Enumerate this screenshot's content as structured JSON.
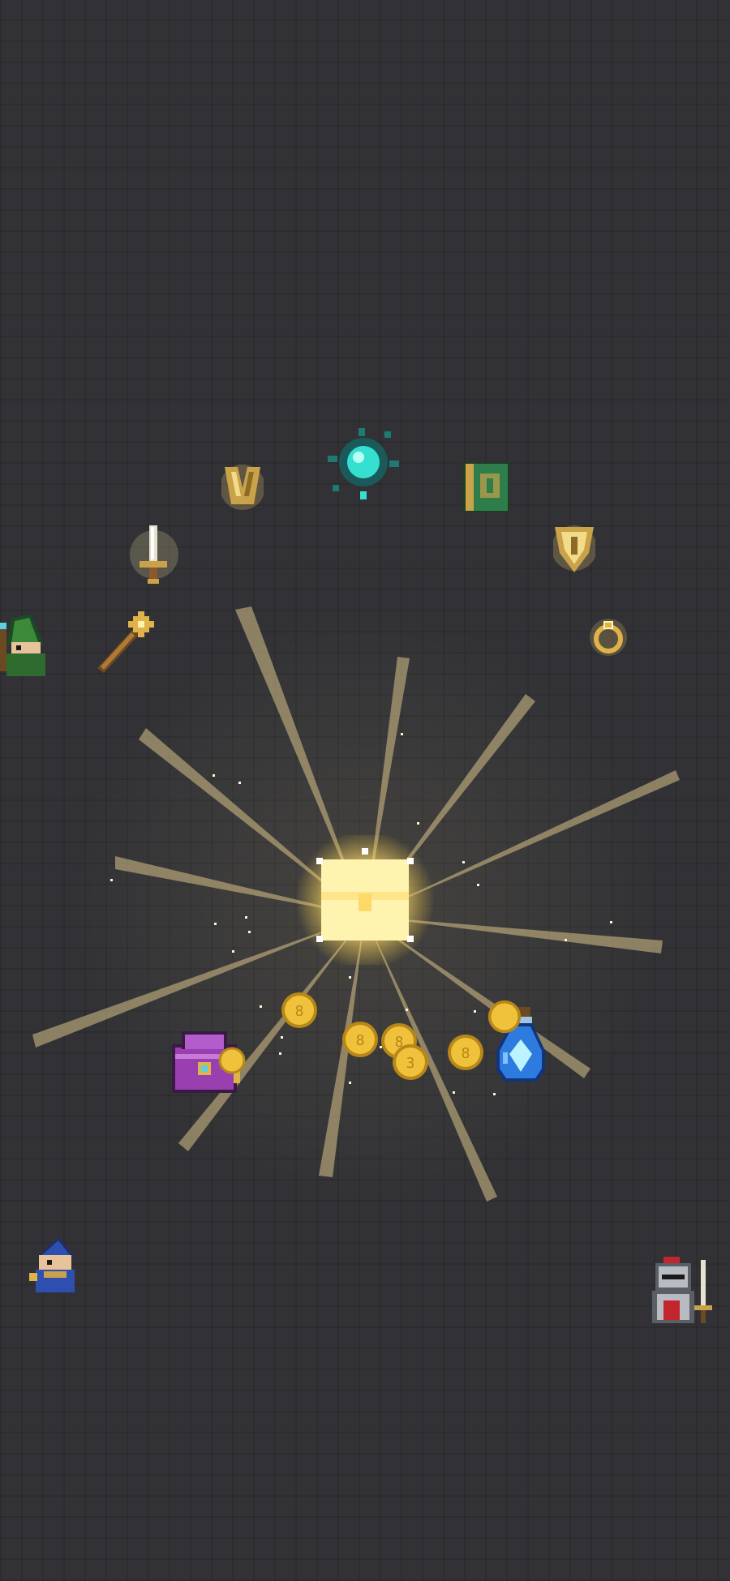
{
  "scene": {
    "background_color": "#323236",
    "light_color": "#fff3b0",
    "ray_color": "#d9c28a"
  },
  "loot": [
    {
      "name": "glowing-chest",
      "icon": "chest-icon"
    },
    {
      "name": "teal-orb",
      "icon": "orb-icon",
      "color": "#36e0d0"
    },
    {
      "name": "spellbook",
      "icon": "book-icon",
      "color": "#2f7d4a"
    },
    {
      "name": "gauntlet",
      "icon": "armor-icon",
      "color": "#c9a24a"
    },
    {
      "name": "shield",
      "icon": "shield-icon",
      "color": "#c9a24a"
    },
    {
      "name": "dagger",
      "icon": "dagger-icon",
      "color": "#d8d2b8"
    },
    {
      "name": "wand",
      "icon": "wand-icon",
      "color": "#b07a34"
    },
    {
      "name": "ring",
      "icon": "ring-icon",
      "color": "#e0b34a"
    },
    {
      "name": "purple-bag",
      "icon": "bag-icon",
      "color": "#9a3fb0"
    },
    {
      "name": "blue-potion",
      "icon": "potion-icon",
      "color": "#2e7be0"
    },
    {
      "name": "gold-coins",
      "icon": "coin-icon",
      "color": "#f0c23c"
    }
  ],
  "characters": [
    {
      "name": "green-wizard",
      "icon": "green-wizard-icon"
    },
    {
      "name": "blue-wizard",
      "icon": "blue-wizard-icon"
    },
    {
      "name": "armored-knight",
      "icon": "knight-icon"
    }
  ]
}
